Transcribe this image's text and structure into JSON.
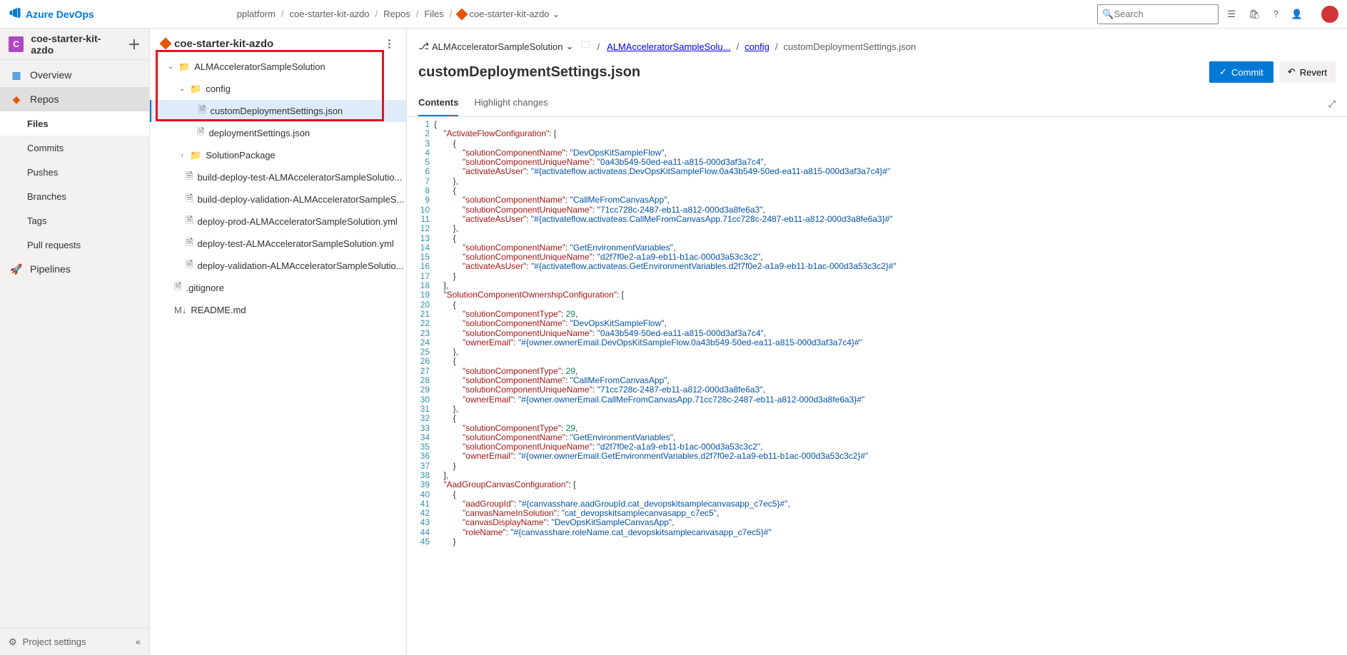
{
  "brand": "Azure DevOps",
  "top_crumbs": [
    "pplatform",
    "coe-starter-kit-azdo",
    "Repos",
    "Files"
  ],
  "repo_name": "coe-starter-kit-azdo",
  "search_placeholder": "Search",
  "project": {
    "letter": "C",
    "name": "coe-starter-kit-azdo"
  },
  "nav": {
    "overview": "Overview",
    "repos": "Repos",
    "files": "Files",
    "commits": "Commits",
    "pushes": "Pushes",
    "branches": "Branches",
    "tags": "Tags",
    "pull_requests": "Pull requests",
    "pipelines": "Pipelines",
    "settings": "Project settings"
  },
  "tree": {
    "root": "coe-starter-kit-azdo",
    "folder1": "ALMAcceleratorSampleSolution",
    "folder2": "config",
    "file_custom": "customDeploymentSettings.json",
    "file_deploy": "deploymentSettings.json",
    "folder3": "SolutionPackage",
    "file_a": "build-deploy-test-ALMAcceleratorSampleSolutio...",
    "file_b": "build-deploy-validation-ALMAcceleratorSampleS...",
    "file_c": "deploy-prod-ALMAcceleratorSampleSolution.yml",
    "file_d": "deploy-test-ALMAcceleratorSampleSolution.yml",
    "file_e": "deploy-validation-ALMAcceleratorSampleSolutio...",
    "file_git": ".gitignore",
    "file_readme": "README.md"
  },
  "content": {
    "branch": "ALMAcceleratorSampleSolution",
    "path": [
      "ALMAcceleratorSampleSolu...",
      "config",
      "customDeploymentSettings.json"
    ],
    "title": "customDeploymentSettings.json",
    "commit": "Commit",
    "revert": "Revert",
    "tab_contents": "Contents",
    "tab_highlight": "Highlight changes"
  },
  "code_lines": [
    [
      [
        "p",
        "{"
      ]
    ],
    [
      [
        "p",
        "    "
      ],
      [
        "k",
        "\"ActivateFlowConfiguration\""
      ],
      [
        "p",
        ": ["
      ]
    ],
    [
      [
        "p",
        "        {"
      ]
    ],
    [
      [
        "p",
        "            "
      ],
      [
        "k",
        "\"solutionComponentName\""
      ],
      [
        "p",
        ": "
      ],
      [
        "s",
        "\"DevOpsKitSampleFlow\""
      ],
      [
        "p",
        ","
      ]
    ],
    [
      [
        "p",
        "            "
      ],
      [
        "k",
        "\"solutionComponentUniqueName\""
      ],
      [
        "p",
        ": "
      ],
      [
        "s",
        "\"0a43b549-50ed-ea11-a815-000d3af3a7c4\""
      ],
      [
        "p",
        ","
      ]
    ],
    [
      [
        "p",
        "            "
      ],
      [
        "k",
        "\"activateAsUser\""
      ],
      [
        "p",
        ": "
      ],
      [
        "s",
        "\"#{activateflow.activateas.DevOpsKitSampleFlow.0a43b549-50ed-ea11-a815-000d3af3a7c4}#\""
      ]
    ],
    [
      [
        "p",
        "        },"
      ]
    ],
    [
      [
        "p",
        "        {"
      ]
    ],
    [
      [
        "p",
        "            "
      ],
      [
        "k",
        "\"solutionComponentName\""
      ],
      [
        "p",
        ": "
      ],
      [
        "s",
        "\"CallMeFromCanvasApp\""
      ],
      [
        "p",
        ","
      ]
    ],
    [
      [
        "p",
        "            "
      ],
      [
        "k",
        "\"solutionComponentUniqueName\""
      ],
      [
        "p",
        ": "
      ],
      [
        "s",
        "\"71cc728c-2487-eb11-a812-000d3a8fe6a3\""
      ],
      [
        "p",
        ","
      ]
    ],
    [
      [
        "p",
        "            "
      ],
      [
        "k",
        "\"activateAsUser\""
      ],
      [
        "p",
        ": "
      ],
      [
        "s",
        "\"#{activateflow.activateas.CallMeFromCanvasApp.71cc728c-2487-eb11-a812-000d3a8fe6a3}#\""
      ]
    ],
    [
      [
        "p",
        "        },"
      ]
    ],
    [
      [
        "p",
        "        {"
      ]
    ],
    [
      [
        "p",
        "            "
      ],
      [
        "k",
        "\"solutionComponentName\""
      ],
      [
        "p",
        ": "
      ],
      [
        "s",
        "\"GetEnvironmentVariables\""
      ],
      [
        "p",
        ","
      ]
    ],
    [
      [
        "p",
        "            "
      ],
      [
        "k",
        "\"solutionComponentUniqueName\""
      ],
      [
        "p",
        ": "
      ],
      [
        "s",
        "\"d2f7f0e2-a1a9-eb11-b1ac-000d3a53c3c2\""
      ],
      [
        "p",
        ","
      ]
    ],
    [
      [
        "p",
        "            "
      ],
      [
        "k",
        "\"activateAsUser\""
      ],
      [
        "p",
        ": "
      ],
      [
        "s",
        "\"#{activateflow.activateas.GetEnvironmentVariables.d2f7f0e2-a1a9-eb11-b1ac-000d3a53c3c2}#\""
      ]
    ],
    [
      [
        "p",
        "        }"
      ]
    ],
    [
      [
        "p",
        "    ],"
      ]
    ],
    [
      [
        "p",
        "    "
      ],
      [
        "k",
        "\"SolutionComponentOwnershipConfiguration\""
      ],
      [
        "p",
        ": ["
      ]
    ],
    [
      [
        "p",
        "        {"
      ]
    ],
    [
      [
        "p",
        "            "
      ],
      [
        "k",
        "\"solutionComponentType\""
      ],
      [
        "p",
        ": "
      ],
      [
        "n",
        "29"
      ],
      [
        "p",
        ","
      ]
    ],
    [
      [
        "p",
        "            "
      ],
      [
        "k",
        "\"solutionComponentName\""
      ],
      [
        "p",
        ": "
      ],
      [
        "s",
        "\"DevOpsKitSampleFlow\""
      ],
      [
        "p",
        ","
      ]
    ],
    [
      [
        "p",
        "            "
      ],
      [
        "k",
        "\"solutionComponentUniqueName\""
      ],
      [
        "p",
        ": "
      ],
      [
        "s",
        "\"0a43b549-50ed-ea11-a815-000d3af3a7c4\""
      ],
      [
        "p",
        ","
      ]
    ],
    [
      [
        "p",
        "            "
      ],
      [
        "k",
        "\"ownerEmail\""
      ],
      [
        "p",
        ": "
      ],
      [
        "s",
        "\"#{owner.ownerEmail.DevOpsKitSampleFlow.0a43b549-50ed-ea11-a815-000d3af3a7c4}#\""
      ]
    ],
    [
      [
        "p",
        "        },"
      ]
    ],
    [
      [
        "p",
        "        {"
      ]
    ],
    [
      [
        "p",
        "            "
      ],
      [
        "k",
        "\"solutionComponentType\""
      ],
      [
        "p",
        ": "
      ],
      [
        "n",
        "29"
      ],
      [
        "p",
        ","
      ]
    ],
    [
      [
        "p",
        "            "
      ],
      [
        "k",
        "\"solutionComponentName\""
      ],
      [
        "p",
        ": "
      ],
      [
        "s",
        "\"CallMeFromCanvasApp\""
      ],
      [
        "p",
        ","
      ]
    ],
    [
      [
        "p",
        "            "
      ],
      [
        "k",
        "\"solutionComponentUniqueName\""
      ],
      [
        "p",
        ": "
      ],
      [
        "s",
        "\"71cc728c-2487-eb11-a812-000d3a8fe6a3\""
      ],
      [
        "p",
        ","
      ]
    ],
    [
      [
        "p",
        "            "
      ],
      [
        "k",
        "\"ownerEmail\""
      ],
      [
        "p",
        ": "
      ],
      [
        "s",
        "\"#{owner.ownerEmail.CallMeFromCanvasApp.71cc728c-2487-eb11-a812-000d3a8fe6a3}#\""
      ]
    ],
    [
      [
        "p",
        "        },"
      ]
    ],
    [
      [
        "p",
        "        {"
      ]
    ],
    [
      [
        "p",
        "            "
      ],
      [
        "k",
        "\"solutionComponentType\""
      ],
      [
        "p",
        ": "
      ],
      [
        "n",
        "29"
      ],
      [
        "p",
        ","
      ]
    ],
    [
      [
        "p",
        "            "
      ],
      [
        "k",
        "\"solutionComponentName\""
      ],
      [
        "p",
        ": "
      ],
      [
        "s",
        "\"GetEnvironmentVariables\""
      ],
      [
        "p",
        ","
      ]
    ],
    [
      [
        "p",
        "            "
      ],
      [
        "k",
        "\"solutionComponentUniqueName\""
      ],
      [
        "p",
        ": "
      ],
      [
        "s",
        "\"d2f7f0e2-a1a9-eb11-b1ac-000d3a53c3c2\""
      ],
      [
        "p",
        ","
      ]
    ],
    [
      [
        "p",
        "            "
      ],
      [
        "k",
        "\"ownerEmail\""
      ],
      [
        "p",
        ": "
      ],
      [
        "s",
        "\"#{owner.ownerEmail.GetEnvironmentVariables.d2f7f0e2-a1a9-eb11-b1ac-000d3a53c3c2}#\""
      ]
    ],
    [
      [
        "p",
        "        }"
      ]
    ],
    [
      [
        "p",
        "    ],"
      ]
    ],
    [
      [
        "p",
        "    "
      ],
      [
        "k",
        "\"AadGroupCanvasConfiguration\""
      ],
      [
        "p",
        ": ["
      ]
    ],
    [
      [
        "p",
        "        {"
      ]
    ],
    [
      [
        "p",
        "            "
      ],
      [
        "k",
        "\"aadGroupId\""
      ],
      [
        "p",
        ": "
      ],
      [
        "s",
        "\"#{canvasshare.aadGroupId.cat_devopskitsamplecanvasapp_c7ec5}#\""
      ],
      [
        "p",
        ","
      ]
    ],
    [
      [
        "p",
        "            "
      ],
      [
        "k",
        "\"canvasNameInSolution\""
      ],
      [
        "p",
        ": "
      ],
      [
        "s",
        "\"cat_devopskitsamplecanvasapp_c7ec5\""
      ],
      [
        "p",
        ","
      ]
    ],
    [
      [
        "p",
        "            "
      ],
      [
        "k",
        "\"canvasDisplayName\""
      ],
      [
        "p",
        ": "
      ],
      [
        "s",
        "\"DevOpsKitSampleCanvasApp\""
      ],
      [
        "p",
        ","
      ]
    ],
    [
      [
        "p",
        "            "
      ],
      [
        "k",
        "\"roleName\""
      ],
      [
        "p",
        ": "
      ],
      [
        "s",
        "\"#{canvasshare.roleName.cat_devopskitsamplecanvasapp_c7ec5}#\""
      ]
    ],
    [
      [
        "p",
        "        }"
      ]
    ]
  ]
}
